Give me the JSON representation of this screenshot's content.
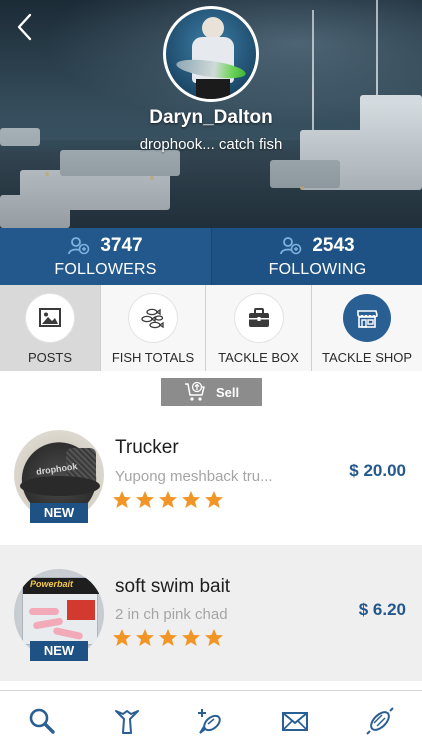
{
  "profile": {
    "username": "Daryn_Dalton",
    "bio": "drophook... catch fish",
    "back_icon": "chevron-left-icon"
  },
  "stats": {
    "followers": {
      "count": "3747",
      "label": "FOLLOWERS",
      "icon": "users-icon"
    },
    "following": {
      "count": "2543",
      "label": "FOLLOWING",
      "icon": "users-icon"
    }
  },
  "tabs": [
    {
      "label": "POSTS",
      "icon": "image-icon",
      "active": true
    },
    {
      "label": "FISH TOTALS",
      "icon": "fish-group-icon",
      "active": false
    },
    {
      "label": "TACKLE BOX",
      "icon": "briefcase-icon",
      "active": false
    },
    {
      "label": "TACKLE SHOP",
      "icon": "store-icon",
      "active": false
    }
  ],
  "sell": {
    "label": "Sell",
    "icon": "cart-upload-icon"
  },
  "products": [
    {
      "title": "Trucker",
      "description": "Yupong meshback tru...",
      "price": "$ 20.00",
      "badge": "NEW",
      "rating": 5,
      "thumb_logo": "drophook"
    },
    {
      "title": "soft swim bait",
      "description": "2 in ch pink chad",
      "price": "$ 6.20",
      "badge": "NEW",
      "rating": 5,
      "thumb_logo": "Powerbait"
    }
  ],
  "bottom_nav": [
    {
      "icon": "search-icon"
    },
    {
      "icon": "fish-tail-icon"
    },
    {
      "icon": "add-fish-icon"
    },
    {
      "icon": "mail-icon"
    },
    {
      "icon": "lure-icon"
    }
  ],
  "colors": {
    "primary": "#23588c",
    "star": "#f29527",
    "muted_text": "#a5a5a5",
    "sell_bg": "#8c8c8c"
  }
}
